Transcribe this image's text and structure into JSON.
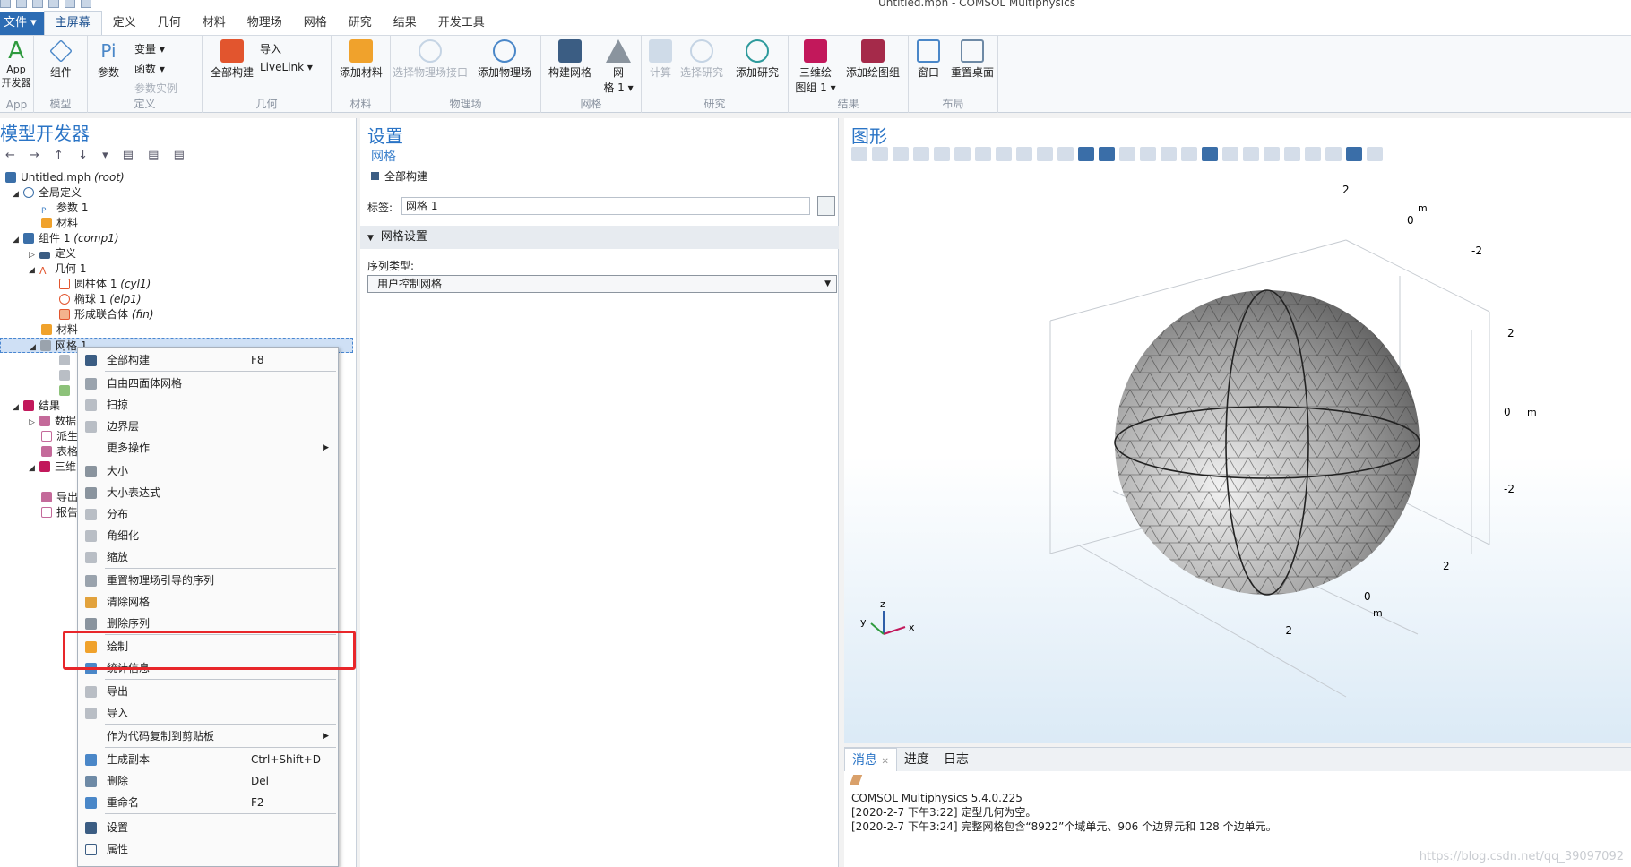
{
  "window": {
    "title": "Untitled.mph - COMSOL Multiphysics"
  },
  "menu": {
    "file": "文件 ▾",
    "tabs": [
      "主屏幕",
      "定义",
      "几何",
      "材料",
      "物理场",
      "网格",
      "研究",
      "结果",
      "开发工具"
    ]
  },
  "ribbon": {
    "app_label": "App\n开发器",
    "groups": {
      "app": "App",
      "model": "模型",
      "definitions": "定义",
      "geometry": "几何",
      "materials": "材料",
      "physics": "物理场",
      "mesh": "网格",
      "study": "研究",
      "results": "结果",
      "layout": "布局"
    },
    "buttons": {
      "component": "组件",
      "parameters": "参数",
      "variables": "变量 ▾",
      "functions": "函数 ▾",
      "param_instance": "参数实例",
      "build_all": "全部构建",
      "import": "导入",
      "livelink": "LiveLink ▾",
      "add_material": "添加材料",
      "physics_interface": "选择物理场接口",
      "add_physics": "添加物理场",
      "build_mesh": "构建网格",
      "mesh1": "网\n格 1 ▾",
      "compute": "计算",
      "select_study": "选择研究",
      "add_study": "添加研究",
      "plot_group_3d": "三维绘\n图组 1 ▾",
      "add_plot_group": "添加绘图组",
      "windows": "窗口",
      "reset_desktop": "重置桌面"
    }
  },
  "model_builder": {
    "title": "模型开发器",
    "root_name": "Untitled.mph",
    "root_tag": "(root)",
    "global_defs": "全局定义",
    "param1": "参数 1",
    "materials": "材料",
    "comp_name": "组件 1",
    "comp_tag": "(comp1)",
    "definitions": "定义",
    "geom_name": "几何 1",
    "cyl_name": "圆柱体 1",
    "cyl_tag": "(cyl1)",
    "elp_name": "椭球 1",
    "elp_tag": "(elp1)",
    "fin_name": "形成联合体",
    "fin_tag": "(fin)",
    "materials2": "材料",
    "mesh_selected": "网格 1",
    "results": "结果",
    "datasets": "数据",
    "derived": "派生",
    "tables": "表格",
    "plot3d": "三维",
    "export": "导出",
    "reports": "报告"
  },
  "context_menu": {
    "items": [
      {
        "label": "全部构建",
        "shortcut": "F8"
      },
      {
        "label": "自由四面体网格",
        "shortcut": ""
      },
      {
        "label": "扫掠",
        "shortcut": ""
      },
      {
        "label": "边界层",
        "shortcut": ""
      },
      {
        "label": "更多操作",
        "shortcut": "",
        "submenu": true
      },
      {
        "label": "大小",
        "shortcut": ""
      },
      {
        "label": "大小表达式",
        "shortcut": ""
      },
      {
        "label": "分布",
        "shortcut": ""
      },
      {
        "label": "角细化",
        "shortcut": ""
      },
      {
        "label": "缩放",
        "shortcut": ""
      },
      {
        "label": "重置物理场引导的序列",
        "shortcut": ""
      },
      {
        "label": "清除网格",
        "shortcut": ""
      },
      {
        "label": "删除序列",
        "shortcut": ""
      },
      {
        "label": "绘制",
        "shortcut": ""
      },
      {
        "label": "统计信息",
        "shortcut": ""
      },
      {
        "label": "导出",
        "shortcut": ""
      },
      {
        "label": "导入",
        "shortcut": ""
      },
      {
        "label": "作为代码复制到剪贴板",
        "shortcut": "",
        "submenu": true
      },
      {
        "label": "生成副本",
        "shortcut": "Ctrl+Shift+D"
      },
      {
        "label": "删除",
        "shortcut": "Del"
      },
      {
        "label": "重命名",
        "shortcut": "F2"
      },
      {
        "label": "设置",
        "shortcut": ""
      },
      {
        "label": "属性",
        "shortcut": ""
      }
    ],
    "submenu_glyph": "▶"
  },
  "settings": {
    "title": "设置",
    "subtitle": "网格",
    "build_all": "全部构建",
    "label_caption": "标签:",
    "label_value": "网格 1",
    "section": "网格设置",
    "sequence_type_caption": "序列类型:",
    "sequence_type_value": "用户控制网格"
  },
  "graphics": {
    "title": "图形",
    "axis_ticks": {
      "z_top": "2",
      "m": "m",
      "zero": "0",
      "neg2": "-2",
      "two": "2"
    },
    "triad": {
      "x": "x",
      "y": "y",
      "z": "z"
    }
  },
  "messages": {
    "tabs": [
      "消息",
      "进度",
      "日志"
    ],
    "close_glyph": "✕",
    "lines": [
      "COMSOL Multiphysics 5.4.0.225",
      "[2020-2-7 下午3:22] 定型几何为空。",
      "[2020-2-7 下午3:24] 完整网格包含“8922”个域单元、906 个边界元和 128 个边单元。"
    ]
  },
  "watermark": "https://blog.csdn.net/qq_39097092",
  "colors": {
    "accent": "#2a74c6",
    "highlight": "#e8262a",
    "file_menu": "#2c6cb4"
  }
}
